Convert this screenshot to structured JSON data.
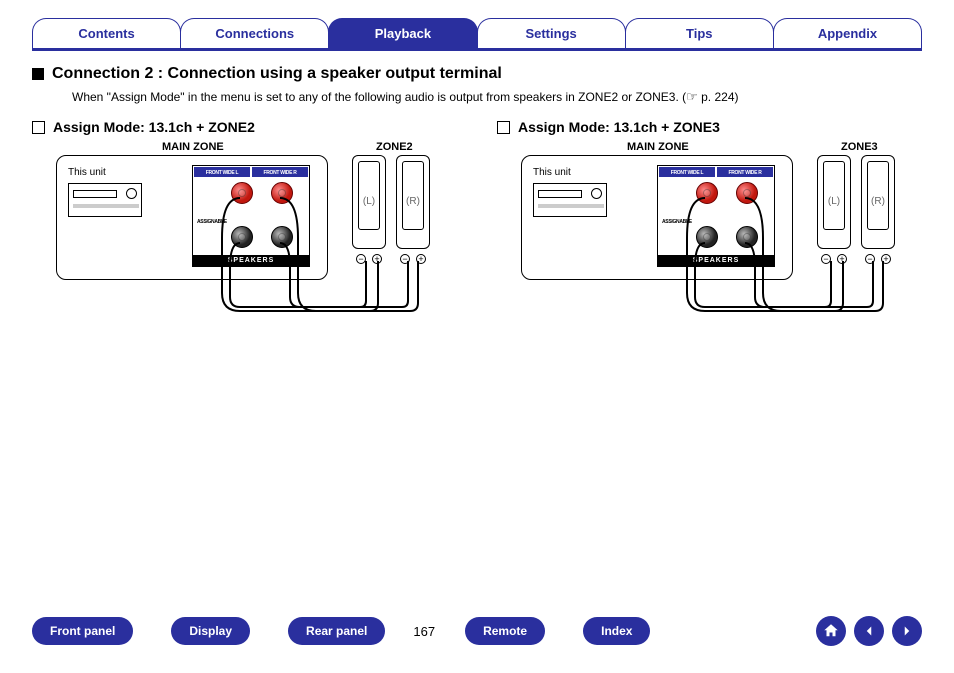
{
  "tabs": [
    {
      "label": "Contents",
      "active": false
    },
    {
      "label": "Connections",
      "active": false
    },
    {
      "label": "Playback",
      "active": true
    },
    {
      "label": "Settings",
      "active": false
    },
    {
      "label": "Tips",
      "active": false
    },
    {
      "label": "Appendix",
      "active": false
    }
  ],
  "section": {
    "title": "Connection 2 : Connection using a speaker output terminal",
    "desc_pre": "When \"Assign Mode\" in the menu is set to any of the following audio is output from speakers in ZONE2 or ZONE3.  (",
    "desc_ref": " p. 224)",
    "columns": [
      {
        "mode": "Assign Mode: 13.1ch + ZONE2",
        "main_label": "MAIN ZONE",
        "zone_label": "ZONE2",
        "unit_label": "This unit",
        "term_l": "FRONT WIDE L",
        "term_r": "FRONT WIDE R",
        "assignable": "ASSIGNABLE",
        "speakers": "SPEAKERS",
        "spk_l": "(L)",
        "spk_r": "(R)"
      },
      {
        "mode": "Assign Mode: 13.1ch + ZONE3",
        "main_label": "MAIN ZONE",
        "zone_label": "ZONE3",
        "unit_label": "This unit",
        "term_l": "FRONT WIDE L",
        "term_r": "FRONT WIDE R",
        "assignable": "ASSIGNABLE",
        "speakers": "SPEAKERS",
        "spk_l": "(L)",
        "spk_r": "(R)"
      }
    ]
  },
  "bottom_nav": {
    "pills": [
      "Front panel",
      "Display",
      "Rear panel"
    ],
    "page": "167",
    "pills2": [
      "Remote",
      "Index"
    ]
  }
}
